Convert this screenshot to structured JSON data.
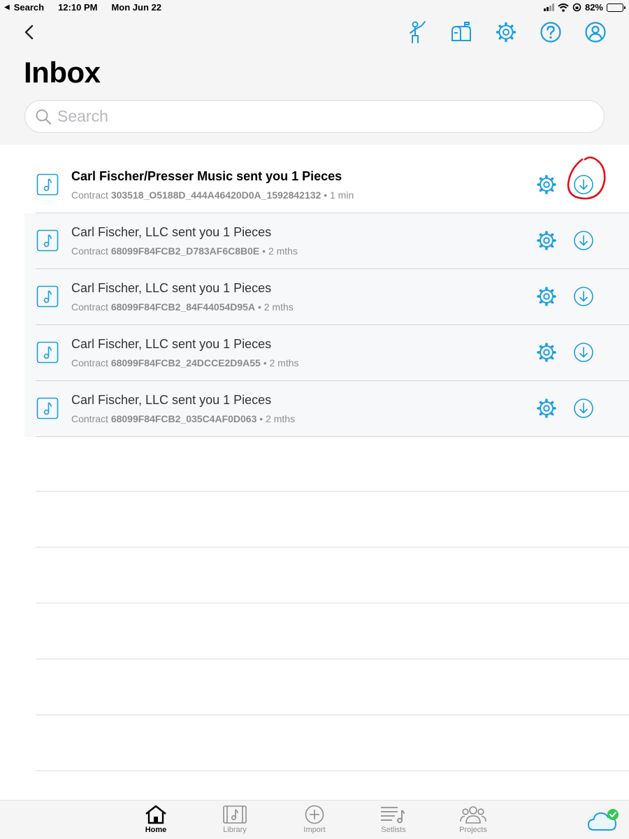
{
  "status_bar": {
    "back_app": "Search",
    "time": "12:10 PM",
    "date": "Mon Jun 22",
    "battery": "82%",
    "battery_level": 0.82
  },
  "header": {
    "title": "Inbox",
    "search_placeholder": "Search",
    "search_value": ""
  },
  "toolbar_icons": [
    "conductor-icon",
    "mailbox-icon",
    "gear-icon",
    "help-icon",
    "account-icon"
  ],
  "inbox": {
    "contract_prefix": "Contract",
    "items": [
      {
        "title": "Carl Fischer/Presser Music sent you 1 Pieces",
        "contract_id": "303518_O5188D_444A46420D0A_1592842132",
        "age": "• 1 min",
        "unread": true
      },
      {
        "title": "Carl Fischer, LLC sent you 1 Pieces",
        "contract_id": "68099F84FCB2_D783AF6C8B0E",
        "age": "• 2 mths",
        "unread": false
      },
      {
        "title": "Carl Fischer, LLC sent you 1 Pieces",
        "contract_id": "68099F84FCB2_84F44054D95A",
        "age": "• 2 mths",
        "unread": false
      },
      {
        "title": "Carl Fischer, LLC sent you 1 Pieces",
        "contract_id": "68099F84FCB2_24DCCE2D9A55",
        "age": "• 2 mths",
        "unread": false
      },
      {
        "title": "Carl Fischer, LLC sent you 1 Pieces",
        "contract_id": "68099F84FCB2_035C4AF0D063",
        "age": "• 2 mths",
        "unread": false
      }
    ]
  },
  "tabs": [
    {
      "label": "Home",
      "icon": "home-icon",
      "active": true
    },
    {
      "label": "Library",
      "icon": "library-icon",
      "active": false
    },
    {
      "label": "Import",
      "icon": "plus-circle-icon",
      "active": false
    },
    {
      "label": "Setlists",
      "icon": "setlist-icon",
      "active": false
    },
    {
      "label": "Projects",
      "icon": "people-icon",
      "active": false
    }
  ],
  "colors": {
    "accent": "#1a9ee0",
    "annotation": "#e0101a",
    "sync_ok": "#34c759"
  }
}
